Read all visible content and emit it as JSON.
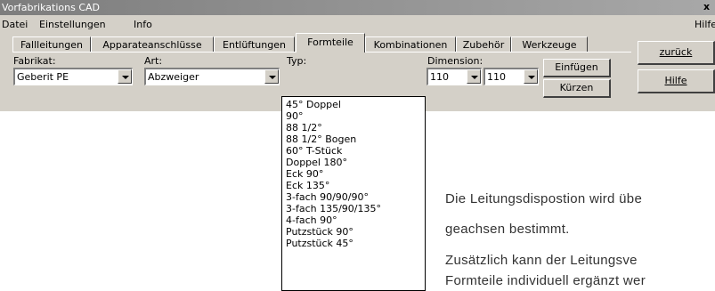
{
  "window": {
    "title": "Vorfabrikations CAD",
    "close_glyph": "x"
  },
  "menu": {
    "datei": "Datei",
    "einstellungen": "Einstellungen",
    "info": "Info",
    "hilfe": "Hilfe"
  },
  "tabs": [
    "Fallleitungen",
    "Apparateanschlüsse",
    "Entlüftungen",
    "Formteile",
    "Kombinationen",
    "Zubehör",
    "Werkzeuge"
  ],
  "active_tab": "Formteile",
  "form": {
    "fabrikat_label": "Fabrikat:",
    "fabrikat_value": "Geberit PE",
    "art_label": "Art:",
    "art_value": "Abzweiger",
    "typ_label": "Typ:",
    "typ_options": [
      "45° Doppel",
      "90°",
      "88 1/2°",
      "88 1/2° Bogen",
      "60° T-Stück",
      "Doppel 180°",
      "Eck 90°",
      "Eck 135°",
      "3-fach 90/90/90°",
      "3-fach 135/90/135°",
      "4-fach 90°",
      "Putzstück 90°",
      "Putzstück 45°"
    ],
    "dimension_label": "Dimension:",
    "dimension_1": "110",
    "dimension_2": "110"
  },
  "buttons": {
    "einfuegen": "Einfügen",
    "kuerzen": "Kürzen",
    "zurueck": "zurück",
    "hilfe": "Hilfe"
  },
  "document": {
    "line1": "Die Leitungsdispostion wird übe",
    "line2": "geachsen bestimmt.",
    "line3": "Zusätzlich kann der Leitungsve",
    "line4": "Formteile individuell ergänzt wer"
  }
}
